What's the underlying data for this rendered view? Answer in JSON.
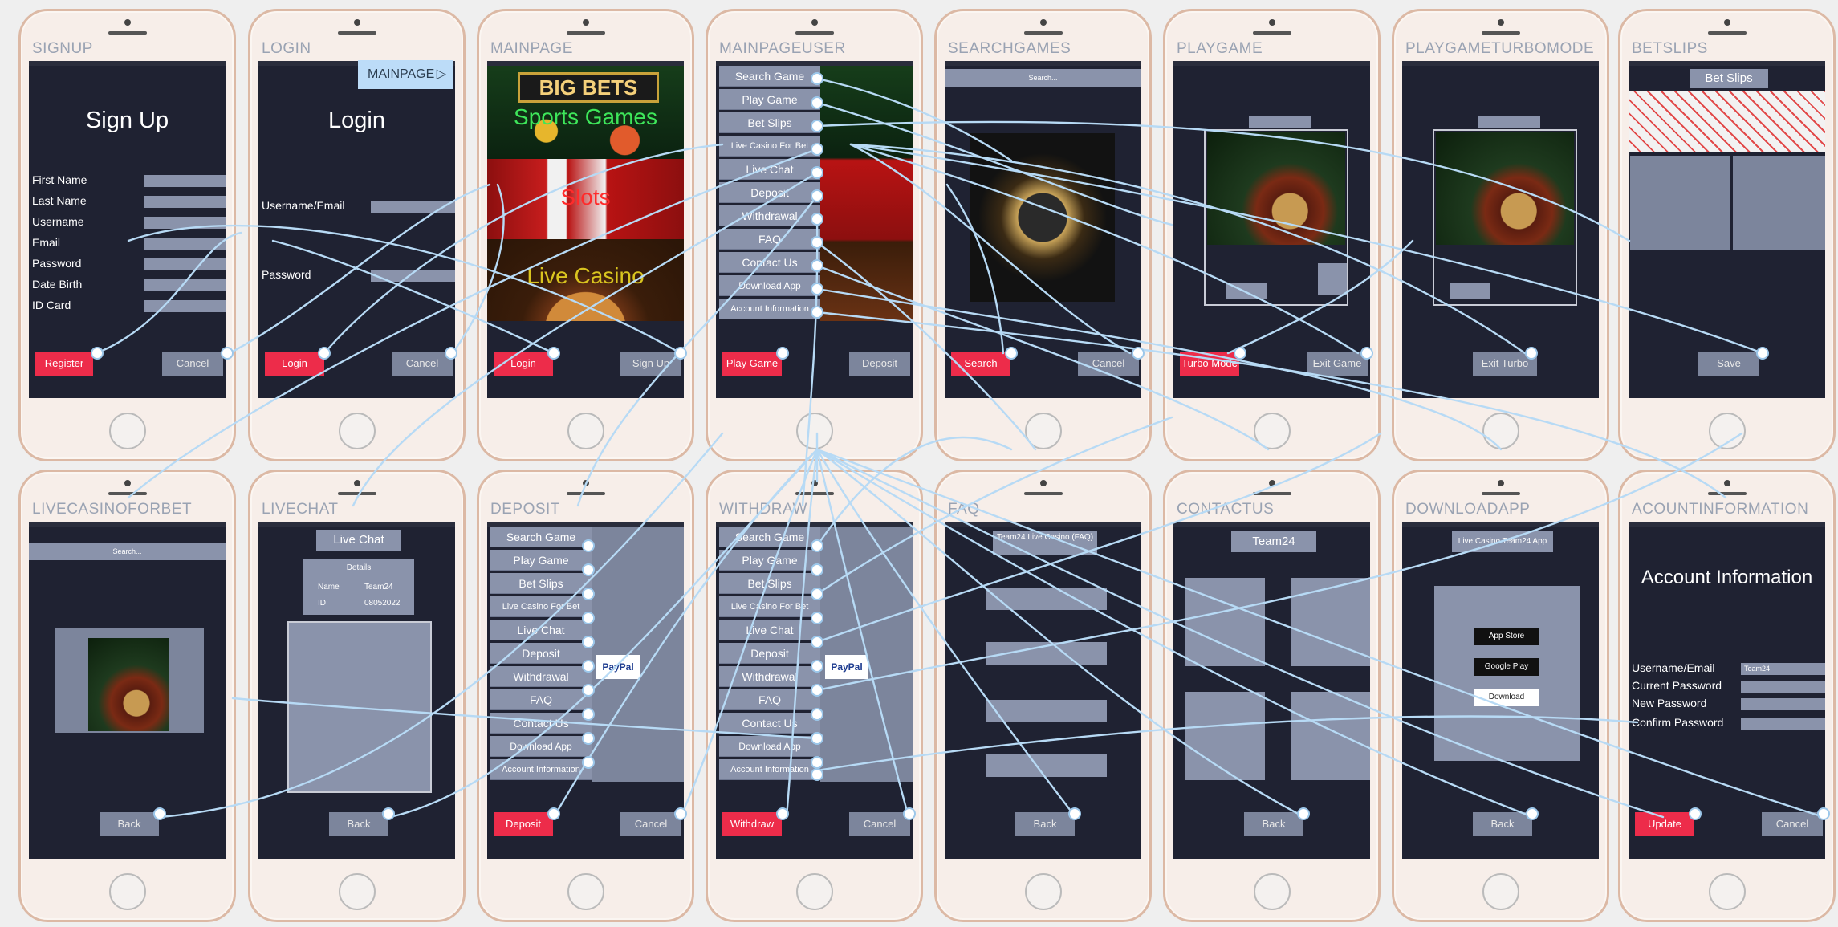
{
  "phones": {
    "signup": "SIGNUP",
    "login": "LOGIN",
    "mainpage": "MAINPAGE",
    "mainpageuser": "MAINPAGEUSER",
    "searchgames": "SEARCHGAMES",
    "playgame": "PLAYGAME",
    "playgameturbomode": "PLAYGAMETURBOMODE",
    "betslips": "BETSLIPS",
    "livecasinoforbet": "LIVECASINOFORBET",
    "livechat": "LIVECHAT",
    "deposit": "DEPOSIT",
    "withdraw": "WITHDRAW",
    "faq": "FAQ",
    "contactus": "CONTACTUS",
    "downloadapp": "DOWNLOADAPP",
    "accountinformation": "ACOUNTINFORMATION"
  },
  "mainpage_tag": "MAINPAGE",
  "signup": {
    "title": "Sign Up",
    "fields": [
      "First Name",
      "Last Name",
      "Username",
      "Email",
      "Password",
      "Date Birth",
      "ID Card"
    ],
    "register": "Register",
    "cancel": "Cancel"
  },
  "login": {
    "title": "Login",
    "username": "Username/Email",
    "password": "Password",
    "login": "Login",
    "cancel": "Cancel"
  },
  "mainpage": {
    "banner": "BIG BETS",
    "sports": "Sports Games",
    "slots": "Slots",
    "live": "Live Casino",
    "login": "Login",
    "signup": "Sign Up"
  },
  "menu": [
    "Search Game",
    "Play Game",
    "Bet Slips",
    "Live Casino For Bet",
    "Live Chat",
    "Deposit",
    "Withdrawal",
    "FAQ",
    "Contact Us",
    "Download App",
    "Account Information"
  ],
  "mainpageuser": {
    "play": "Play Game",
    "deposit": "Deposit"
  },
  "searchgames": {
    "search": "Search",
    "cancel": "Cancel",
    "bar": "Search..."
  },
  "playgame": {
    "turbo": "Turbo Mode",
    "exit": "Exit Game"
  },
  "playgameturbo": {
    "exit": "Exit Turbo"
  },
  "betslips": {
    "header": "Bet Slips",
    "save": "Save"
  },
  "livecasino": {
    "bar": "Search...",
    "back": "Back"
  },
  "livechat": {
    "header": "Live Chat",
    "details": "Details",
    "name_label": "Name",
    "name_value": "Team24",
    "id_label": "ID",
    "id_value": "08052022",
    "back": "Back"
  },
  "deposit": {
    "deposit": "Deposit",
    "cancel": "Cancel",
    "paypal": "PayPal"
  },
  "withdraw": {
    "withdraw": "Withdraw",
    "cancel": "Cancel",
    "paypal": "PayPal"
  },
  "faq": {
    "header": "Team24 Live Casino (FAQ)",
    "back": "Back"
  },
  "contactus": {
    "header": "Team24",
    "back": "Back"
  },
  "downloadapp": {
    "header": "Live Casino Team24 App",
    "appstore": "App Store",
    "googleplay": "Google Play",
    "download": "Download",
    "back": "Back"
  },
  "account": {
    "title": "Account Information",
    "fields": [
      "Username/Email",
      "Current Password",
      "New Password",
      "Confirm Password"
    ],
    "username_value": "Team24",
    "update": "Update",
    "cancel": "Cancel"
  },
  "colors": {
    "screen": "#1f2232",
    "accent": "#ed2c4a",
    "panel": "#8a93ab",
    "link": "#9cc7ea"
  }
}
